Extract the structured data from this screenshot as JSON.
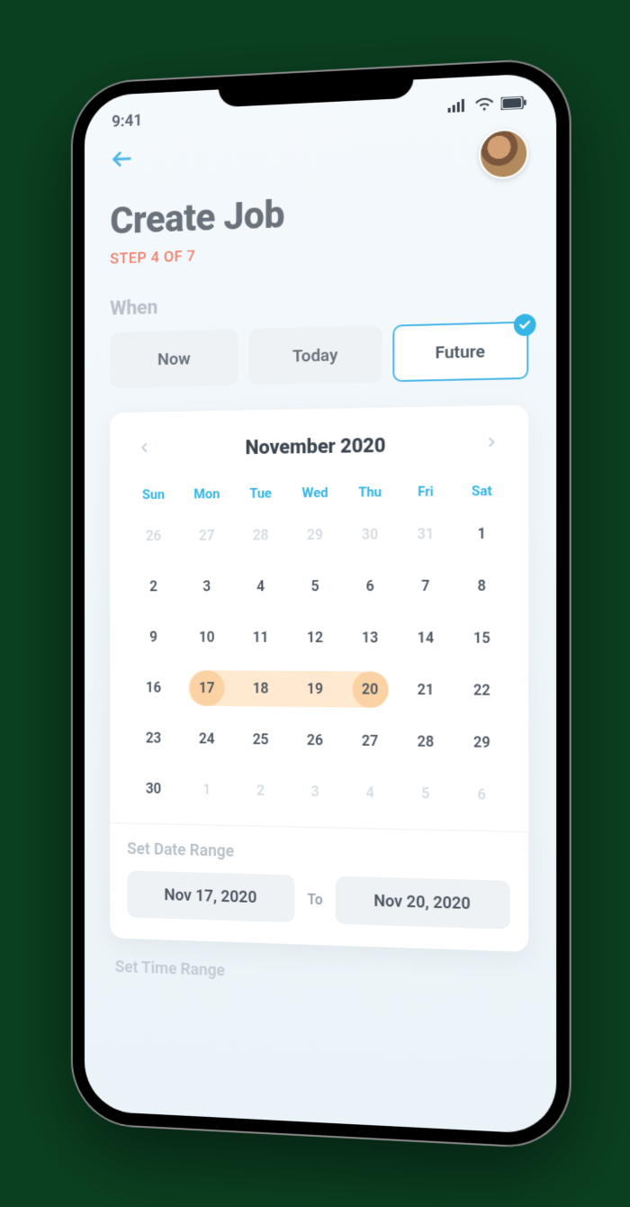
{
  "status": {
    "time": "9:41"
  },
  "header": {
    "title": "Create Job",
    "step": "STEP 4 OF 7"
  },
  "when": {
    "label": "When",
    "options": [
      "Now",
      "Today",
      "Future"
    ],
    "selected": 2
  },
  "calendar": {
    "title": "November 2020",
    "dow": [
      "Sun",
      "Mon",
      "Tue",
      "Wed",
      "Thu",
      "Fri",
      "Sat"
    ],
    "weeks": [
      [
        {
          "n": "26",
          "dim": true
        },
        {
          "n": "27",
          "dim": true
        },
        {
          "n": "28",
          "dim": true
        },
        {
          "n": "29",
          "dim": true
        },
        {
          "n": "30",
          "dim": true
        },
        {
          "n": "31",
          "dim": true
        },
        {
          "n": "1"
        }
      ],
      [
        {
          "n": "2"
        },
        {
          "n": "3"
        },
        {
          "n": "4"
        },
        {
          "n": "5"
        },
        {
          "n": "6"
        },
        {
          "n": "7"
        },
        {
          "n": "8"
        }
      ],
      [
        {
          "n": "9"
        },
        {
          "n": "10"
        },
        {
          "n": "11"
        },
        {
          "n": "12"
        },
        {
          "n": "13"
        },
        {
          "n": "14"
        },
        {
          "n": "15"
        }
      ],
      [
        {
          "n": "16"
        },
        {
          "n": "17",
          "sel": true
        },
        {
          "n": "18",
          "in": true
        },
        {
          "n": "19",
          "in": true
        },
        {
          "n": "20",
          "sel": true
        },
        {
          "n": "21"
        },
        {
          "n": "22"
        }
      ],
      [
        {
          "n": "23"
        },
        {
          "n": "24"
        },
        {
          "n": "25"
        },
        {
          "n": "26"
        },
        {
          "n": "27"
        },
        {
          "n": "28"
        },
        {
          "n": "29"
        }
      ],
      [
        {
          "n": "30"
        },
        {
          "n": "1",
          "dim": true
        },
        {
          "n": "2",
          "dim": true
        },
        {
          "n": "3",
          "dim": true
        },
        {
          "n": "4",
          "dim": true
        },
        {
          "n": "5",
          "dim": true
        },
        {
          "n": "6",
          "dim": true
        }
      ]
    ],
    "range": {
      "label": "Set Date Range",
      "from": "Nov 17, 2020",
      "to_label": "To",
      "to": "Nov 20, 2020"
    },
    "time_label": "Set Time Range"
  }
}
